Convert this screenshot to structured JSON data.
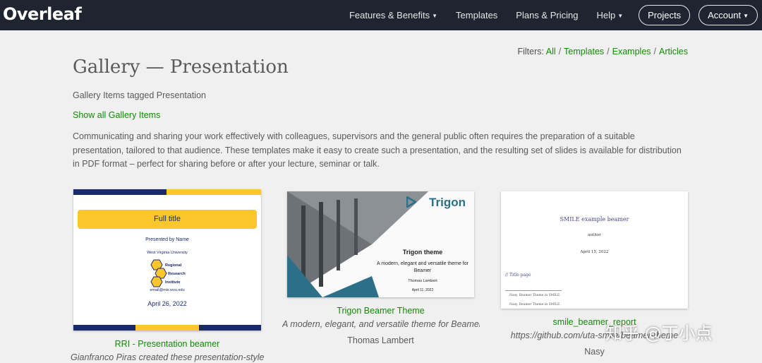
{
  "navbar": {
    "logo": "Overleaf",
    "items": [
      "Features & Benefits",
      "Templates",
      "Plans & Pricing",
      "Help"
    ],
    "projects": "Projects",
    "account": "Account"
  },
  "filters": {
    "label": "Filters:",
    "options": [
      "All",
      "Templates",
      "Examples",
      "Articles"
    ]
  },
  "page": {
    "title": "Gallery — Presentation",
    "tagged": "Gallery Items tagged Presentation",
    "show_all": "Show all Gallery Items",
    "description": "Communicating and sharing your work effectively with colleagues, supervisors and the general public often requires the preparation of a suitable presentation, tailored to that audience. These templates make it easy to create such a presentation, and the resulting set of slides is available for distribution in PDF format – perfect for sharing before or after your lecture, seminar or talk."
  },
  "cards": [
    {
      "title": "RRI - Presentation beamer",
      "description": "Gianfranco Piras created these presentation-style fi...",
      "thumb": {
        "bar_title": "Full title",
        "presented": "Presented by Name",
        "university": "West Virginia University",
        "institute": [
          "Regional",
          "Research",
          "Institute"
        ],
        "email": "email@mix.wvu.edu",
        "date": "April 26, 2022"
      }
    },
    {
      "title": "Trigon Beamer Theme",
      "description": "A modern, elegant, and versatile theme for Beamer...",
      "author": "Thomas Lambert",
      "thumb": {
        "brand": "Trigon",
        "slide_title": "Trigon theme",
        "subtitle": "A modern, elegant and versatile theme for Beamer",
        "author": "Thomas Lambert",
        "date": "April 11, 2022"
      }
    },
    {
      "title": "smile_beamer_report",
      "description": "https://github.com/uta-smile/beamer-theme",
      "author": "Nasy",
      "thumb": {
        "title": "SMILE example beamer",
        "author": "author",
        "date": "April 15, 2022",
        "section": "// Title page",
        "footnote1": "Nasy. Beamer Theme in SMILE.",
        "footnote2": "Nasy. Beamer Theme in SMILE."
      }
    }
  ],
  "watermark": "知乎 @丁小点"
}
